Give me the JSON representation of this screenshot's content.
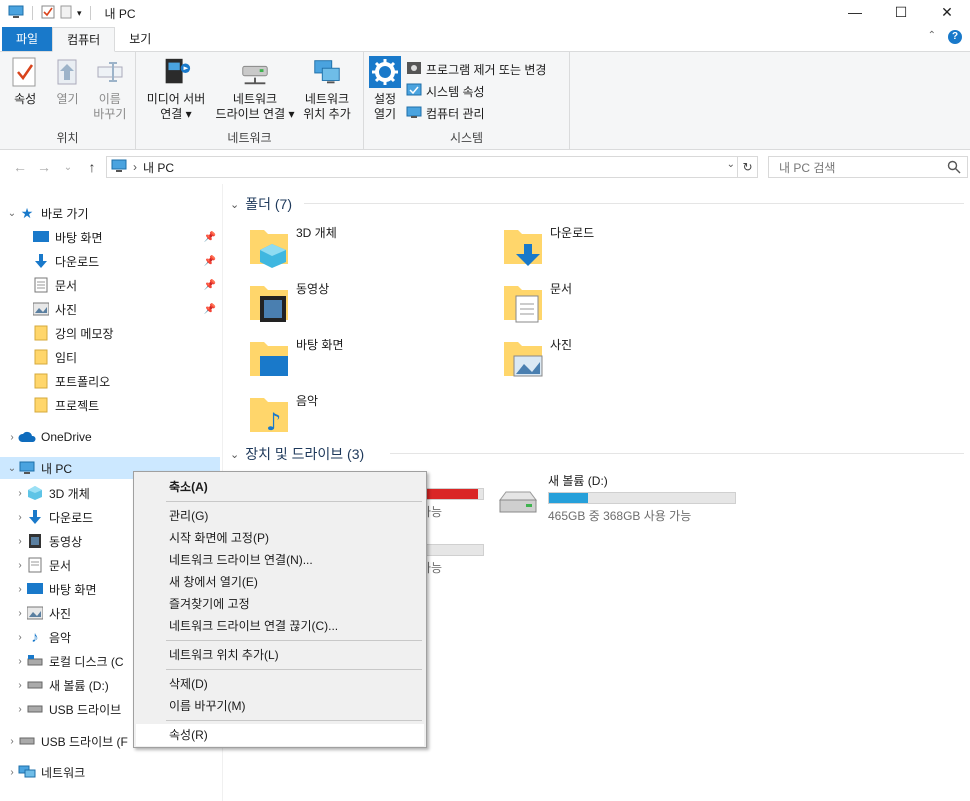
{
  "window": {
    "title": "내 PC",
    "controls": {
      "minimize": "—",
      "maximize": "☐",
      "close": "✕"
    }
  },
  "ribbon": {
    "tabs": [
      {
        "label": "파일",
        "state": "file"
      },
      {
        "label": "컴퓨터",
        "state": "active"
      },
      {
        "label": "보기",
        "state": "normal"
      }
    ],
    "groups": {
      "location": {
        "label": "위치",
        "buttons": [
          {
            "label": "속성",
            "icon": "properties-check-icon"
          },
          {
            "label": "열기",
            "icon": "open-icon"
          },
          {
            "label": "이름\n바꾸기",
            "icon": "rename-icon"
          }
        ]
      },
      "network": {
        "label": "네트워크",
        "buttons": [
          {
            "label": "미디어 서버\n연결 ▾",
            "icon": "media-server-icon"
          },
          {
            "label": "네트워크\n드라이브 연결 ▾",
            "icon": "map-drive-icon"
          },
          {
            "label": "네트워크\n위치 추가",
            "icon": "network-location-icon"
          }
        ]
      },
      "system": {
        "label": "시스템",
        "open_settings": "설정\n열기",
        "items": [
          {
            "label": "프로그램 제거 또는 변경",
            "icon": "uninstall-icon"
          },
          {
            "label": "시스템 속성",
            "icon": "system-properties-icon"
          },
          {
            "label": "컴퓨터 관리",
            "icon": "computer-management-icon"
          }
        ]
      }
    }
  },
  "addressbar": {
    "path": "내 PC",
    "search_placeholder": "내 PC 검색"
  },
  "navpane": {
    "quick_access": "바로 가기",
    "quick_items": [
      {
        "label": "바탕 화면",
        "pinned": true,
        "icon": "desktop-icon"
      },
      {
        "label": "다운로드",
        "pinned": true,
        "icon": "download-icon"
      },
      {
        "label": "문서",
        "pinned": true,
        "icon": "documents-icon"
      },
      {
        "label": "사진",
        "pinned": true,
        "icon": "pictures-icon"
      },
      {
        "label": "강의 메모장",
        "pinned": false,
        "icon": "folder-icon"
      },
      {
        "label": "임티",
        "pinned": false,
        "icon": "folder-icon"
      },
      {
        "label": "포트폴리오",
        "pinned": false,
        "icon": "folder-icon"
      },
      {
        "label": "프로젝트",
        "pinned": false,
        "icon": "folder-icon"
      }
    ],
    "onedrive": "OneDrive",
    "this_pc": "내 PC",
    "pc_items": [
      {
        "label": "3D 개체",
        "icon": "3d-objects-icon"
      },
      {
        "label": "다운로드",
        "icon": "download-icon"
      },
      {
        "label": "동영상",
        "icon": "videos-icon"
      },
      {
        "label": "문서",
        "icon": "documents-icon"
      },
      {
        "label": "바탕 화면",
        "icon": "desktop-icon"
      },
      {
        "label": "사진",
        "icon": "pictures-icon"
      },
      {
        "label": "음악",
        "icon": "music-icon"
      },
      {
        "label": "로컬 디스크 (C",
        "icon": "local-disk-icon"
      },
      {
        "label": "새 볼륨 (D:)",
        "icon": "drive-icon"
      },
      {
        "label": "USB 드라이브",
        "icon": "usb-drive-icon"
      }
    ],
    "usb_root": "USB 드라이브 (F",
    "network": "네트워크"
  },
  "content": {
    "folders_header": "폴더 (7)",
    "folders": [
      {
        "label": "3D 개체",
        "icon": "3d-objects-folder-icon"
      },
      {
        "label": "다운로드",
        "icon": "downloads-folder-icon"
      },
      {
        "label": "동영상",
        "icon": "videos-folder-icon"
      },
      {
        "label": "문서",
        "icon": "documents-folder-icon"
      },
      {
        "label": "바탕 화면",
        "icon": "desktop-folder-icon"
      },
      {
        "label": "사진",
        "icon": "pictures-folder-icon"
      },
      {
        "label": "음악",
        "icon": "music-folder-icon"
      }
    ],
    "drives_header": "장치 및 드라이브 (3)",
    "drives": [
      {
        "name": "",
        "free": "가능",
        "used_fraction": 0.92,
        "color": "#da2626"
      },
      {
        "name": "새 볼륨 (D:)",
        "free": "465GB 중 368GB 사용 가능",
        "used_fraction": 0.21,
        "color": "#26a0da"
      },
      {
        "name": "",
        "free": "가능",
        "used_fraction": 0.0,
        "color": "#26a0da"
      }
    ]
  },
  "context_menu": {
    "items": [
      {
        "label": "축소(A)",
        "bold": true
      },
      {
        "sep": true
      },
      {
        "label": "관리(G)"
      },
      {
        "label": "시작 화면에 고정(P)"
      },
      {
        "label": "네트워크 드라이브 연결(N)..."
      },
      {
        "label": "새 창에서 열기(E)"
      },
      {
        "label": "즐겨찾기에 고정"
      },
      {
        "label": "네트워크 드라이브 연결 끊기(C)..."
      },
      {
        "sep": true
      },
      {
        "label": "네트워크 위치 추가(L)"
      },
      {
        "sep": true
      },
      {
        "label": "삭제(D)"
      },
      {
        "label": "이름 바꾸기(M)"
      },
      {
        "sep": true
      },
      {
        "label": "속성(R)",
        "hover": true
      }
    ]
  }
}
